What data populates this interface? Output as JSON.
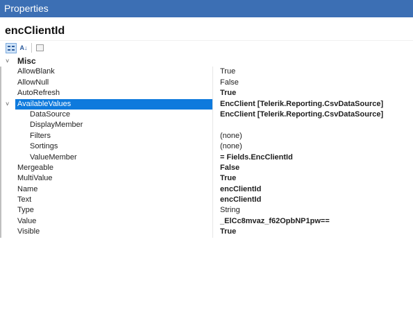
{
  "titlebar": {
    "title": "Properties"
  },
  "object": {
    "name": "encClientId"
  },
  "toolbar": {
    "categorized_icon": "categorized-icon",
    "alphabetical_icon": "alphabetical-sort-icon",
    "alphabetical_label": "A↓",
    "pages_icon": "property-pages-icon"
  },
  "grid": {
    "category": {
      "label": "Misc",
      "toggle": "˅"
    },
    "rows": [
      {
        "name": "AllowBlank",
        "value": "True",
        "bold": false
      },
      {
        "name": "AllowNull",
        "value": "False",
        "bold": false
      },
      {
        "name": "AutoRefresh",
        "value": "True",
        "bold": true
      },
      {
        "name": "AvailableValues",
        "value": "EncClient [Telerik.Reporting.CsvDataSource]",
        "bold": true,
        "toggle": "˅",
        "selected": true
      },
      {
        "name": "DataSource",
        "value": "EncClient [Telerik.Reporting.CsvDataSource]",
        "bold": true,
        "sub": true
      },
      {
        "name": "DisplayMember",
        "value": "",
        "bold": false,
        "sub": true
      },
      {
        "name": "Filters",
        "value": "(none)",
        "bold": false,
        "sub": true
      },
      {
        "name": "Sortings",
        "value": "(none)",
        "bold": false,
        "sub": true
      },
      {
        "name": "ValueMember",
        "value": "= Fields.EncClientId",
        "bold": true,
        "sub": true
      },
      {
        "name": "Mergeable",
        "value": "False",
        "bold": true
      },
      {
        "name": "MultiValue",
        "value": "True",
        "bold": true
      },
      {
        "name": "Name",
        "value": "encClientId",
        "bold": true
      },
      {
        "name": "Text",
        "value": "encClientId",
        "bold": true
      },
      {
        "name": "Type",
        "value": "String",
        "bold": false
      },
      {
        "name": "Value",
        "value": "_ElCc8mvaz_f62OpbNP1pw==",
        "bold": true
      },
      {
        "name": "Visible",
        "value": "True",
        "bold": true
      }
    ]
  },
  "colors": {
    "titlebar": "#3c6fb4",
    "selection": "#0e7add"
  }
}
